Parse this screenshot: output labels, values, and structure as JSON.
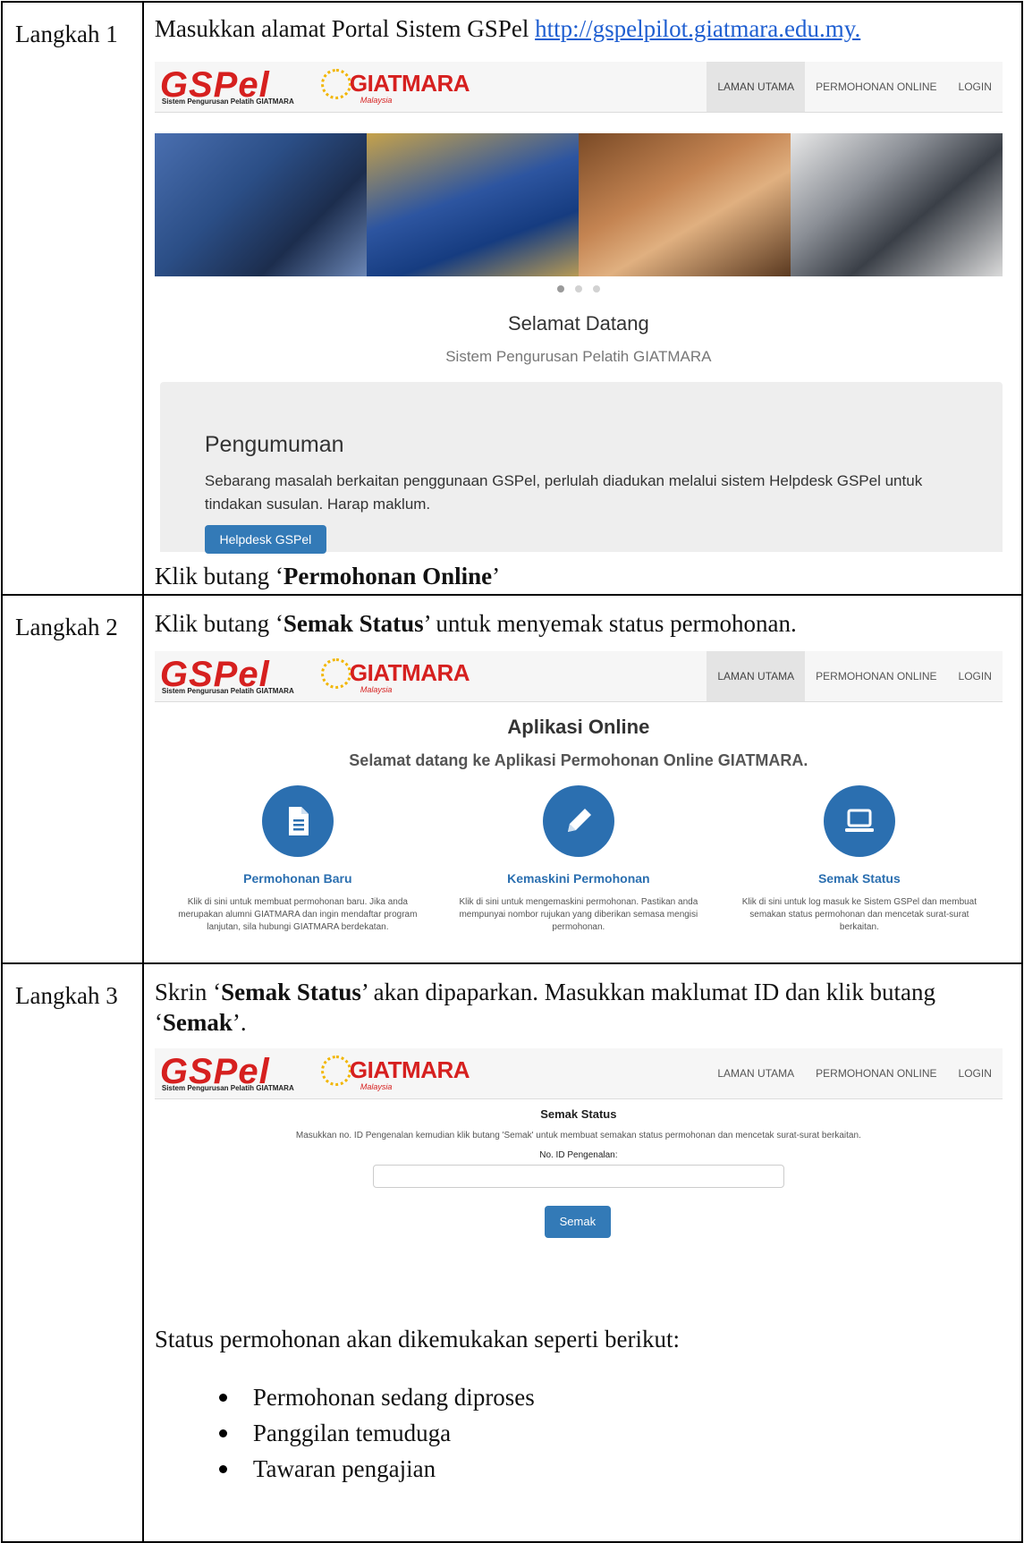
{
  "step1": {
    "label": "Langkah 1",
    "intro": "Masukkan alamat Portal Sistem GSPel",
    "url": "http://gspelpilot.giatmara.edu.my.",
    "welcome_title": "Selamat Datang",
    "welcome_subtitle": "Sistem Pengurusan Pelatih GIATMARA",
    "announcement_title": "Pengumuman",
    "announcement_text": "Sebarang masalah berkaitan penggunaan GSPel, perlulah diadukan melalui sistem Helpdesk GSPel untuk tindakan susulan. Harap maklum.",
    "helpdesk_button": "Helpdesk GSPel",
    "action_prefix": "Klik butang ‘",
    "action_bold": "Permohonan Online",
    "action_suffix": "’"
  },
  "step2": {
    "label": "Langkah 2",
    "instr_prefix": "Klik butang ‘",
    "instr_bold": "Semak Status",
    "instr_suffix": "’ untuk menyemak status permohonan.",
    "page_title": "Aplikasi Online",
    "page_subtitle": "Selamat datang ke Aplikasi Permohonan Online GIATMARA.",
    "cards": [
      {
        "title": "Permohonan Baru",
        "desc": "Klik di sini untuk membuat permohonan baru. Jika anda merupakan alumni GIATMARA dan ingin mendaftar program lanjutan, sila hubungi GIATMARA berdekatan.",
        "icon": "document-icon"
      },
      {
        "title": "Kemaskini Permohonan",
        "desc": "Klik di sini untuk mengemaskini permohonan. Pastikan anda mempunyai nombor rujukan yang diberikan semasa mengisi permohonan.",
        "icon": "pencil-icon"
      },
      {
        "title": "Semak Status",
        "desc": "Klik di sini untuk log masuk ke Sistem GSPel dan membuat semakan status permohonan dan mencetak surat-surat berkaitan.",
        "icon": "laptop-icon"
      }
    ]
  },
  "step3": {
    "label": "Langkah 3",
    "instr_prefix": "Skrin ‘",
    "instr_bold1": "Semak Status",
    "instr_mid": "’ akan dipaparkan. Masukkan maklumat ID dan klik butang ‘",
    "instr_bold2": "Semak",
    "instr_suffix": "’.",
    "form_title": "Semak Status",
    "form_desc": "Masukkan no. ID Pengenalan kemudian klik butang 'Semak' untuk membuat semakan status permohonan dan mencetak surat-surat berkaitan.",
    "field_label": "No. ID Pengenalan:",
    "field_value": "",
    "submit_button": "Semak",
    "status_intro": "Status permohonan akan dikemukakan seperti berikut:",
    "statuses": [
      "Permohonan sedang diproses",
      "Panggilan temuduga",
      "Tawaran pengajian"
    ]
  },
  "brand": {
    "gspel": "GSPel",
    "gspel_sub": "Sistem Pengurusan Pelatih GIATMARA",
    "giatmara": "GIATMARA",
    "giatmara_sub": "Malaysia",
    "accent": "#337ab7",
    "red": "#d6201f"
  },
  "nav": {
    "home": "LAMAN UTAMA",
    "online": "PERMOHONAN ONLINE",
    "login": "LOGIN"
  }
}
